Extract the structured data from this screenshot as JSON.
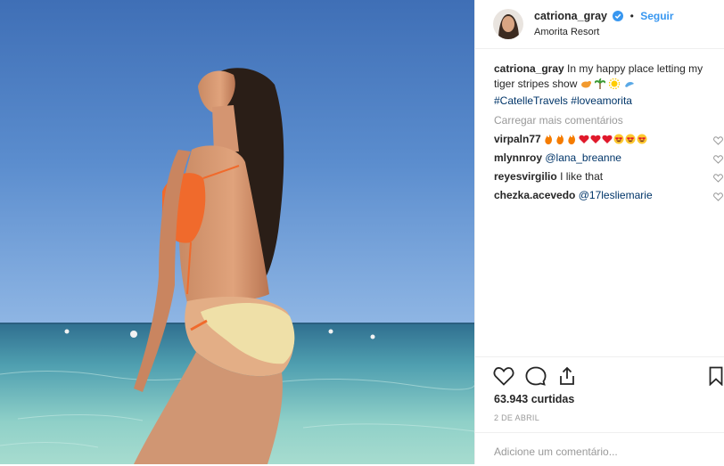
{
  "post": {
    "username": "catriona_gray",
    "follow_label": "Seguir",
    "separator": "•",
    "location": "Amorita Resort"
  },
  "caption": {
    "username": "catriona_gray",
    "text": "In my happy place letting my tiger stripes show",
    "emojis": [
      "tiger-emoji",
      "palm-tree-emoji",
      "sun-emoji",
      "dolphin-emoji"
    ],
    "hashtag_1": "#CatelleTravels",
    "hashtag_2": "#loveamorita"
  },
  "load_more_label": "Carregar mais comentários",
  "comments": [
    {
      "username": "virpaln77",
      "text": "",
      "emojis": [
        "fire",
        "fire",
        "fire",
        "red-heart",
        "red-heart",
        "red-heart",
        "heart-eyes",
        "heart-eyes",
        "heart-eyes"
      ]
    },
    {
      "username": "mlynnroy",
      "text": "@lana_breanne"
    },
    {
      "username": "reyesvirgilio",
      "text": "I like that"
    },
    {
      "username": "chezka.acevedo",
      "text": "@17lesliemarie"
    }
  ],
  "likes_label": "63.943 curtidas",
  "date_label": "2 DE ABRIL",
  "add_comment_placeholder": "Adicione um comentário...",
  "colors": {
    "link": "#3897f0",
    "mention": "#003569",
    "muted": "#999999",
    "border": "#efefef"
  }
}
